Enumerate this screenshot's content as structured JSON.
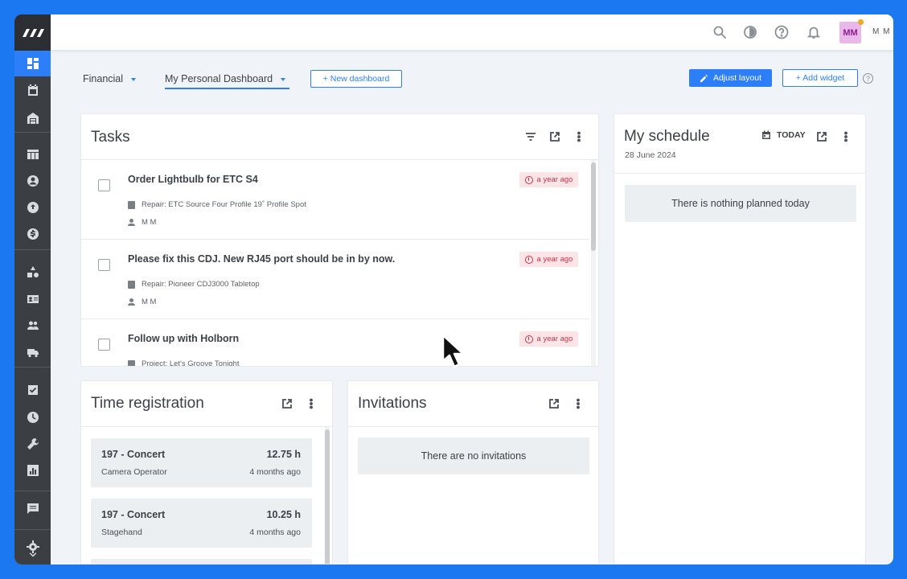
{
  "app": {
    "user_initials": "MM",
    "user_name": "M M"
  },
  "sidebar": {
    "items": [
      {
        "icon": "dashboard-icon",
        "active": true
      },
      {
        "icon": "calendar-icon"
      },
      {
        "icon": "warehouse-icon"
      },
      {
        "icon": "table-icon"
      },
      {
        "icon": "contact-icon"
      },
      {
        "icon": "sync-icon"
      },
      {
        "icon": "dollar-icon"
      },
      {
        "icon": "shapes-icon"
      },
      {
        "icon": "id-card-icon"
      },
      {
        "icon": "people-icon"
      },
      {
        "icon": "truck-icon"
      },
      {
        "icon": "checkbox-icon"
      },
      {
        "icon": "clock-icon"
      },
      {
        "icon": "wrench-icon"
      },
      {
        "icon": "report-icon"
      },
      {
        "icon": "message-icon"
      },
      {
        "icon": "settings-icon"
      }
    ]
  },
  "dashboard_tabs": {
    "financial": "Financial",
    "personal": "My Personal Dashboard"
  },
  "buttons": {
    "new_dashboard": "+   New dashboard",
    "adjust_layout": "Adjust layout",
    "add_widget": "+   Add widget"
  },
  "tasks": {
    "title": "Tasks",
    "items": [
      {
        "title": "Order Lightbulb for ETC S4",
        "ago": "a year ago",
        "subject": "Repair: ETC Source Four Profile 19˚ Profile Spot",
        "assignee": "M M"
      },
      {
        "title": "Please fix this CDJ. New RJ45 port should be in by now.",
        "ago": "a year ago",
        "subject": "Repair: Pioneer CDJ3000 Tabletop",
        "assignee": "M M"
      },
      {
        "title": "Follow up with Holborn",
        "ago": "a year ago",
        "subject": "Project: Let's Groove Tonight",
        "assignee": ""
      }
    ]
  },
  "schedule": {
    "title": "My schedule",
    "date": "28 June 2024",
    "today_label": "TODAY",
    "empty": "There is nothing planned today"
  },
  "time_registration": {
    "title": "Time registration",
    "items": [
      {
        "name": "197 - Concert",
        "hours": "12.75 h",
        "role": "Camera Operator",
        "ago": "4 months ago"
      },
      {
        "name": "197 - Concert",
        "hours": "10.25 h",
        "role": "Stagehand",
        "ago": "4 months ago"
      }
    ]
  },
  "invitations": {
    "title": "Invitations",
    "empty": "There are no invitations"
  },
  "colors": {
    "accent": "#2d7ff9",
    "sidebar": "#3b3f44",
    "frame_bg": "#1c78f0",
    "badge_bg": "#fde4e7",
    "badge_fg": "#d0334a"
  }
}
